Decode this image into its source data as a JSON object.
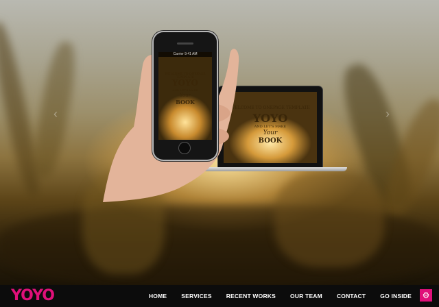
{
  "brand": {
    "logo_text": "YOYO",
    "accent_color": "#e0107a"
  },
  "hero": {
    "phone_status": "Carrier  9:41 AM",
    "badge_line1": "WELCOME TO ONEPAGE TEMPLATE",
    "badge_brand": "YOYO",
    "badge_line2": "AND LET'S MAKE",
    "badge_line3": "Your",
    "badge_line4": "BOOK"
  },
  "nav": {
    "items": [
      "HOME",
      "SERVICES",
      "RECENT WORKS",
      "OUR TEAM",
      "CONTACT",
      "GO INSIDE"
    ],
    "settings_icon": "gear-icon"
  }
}
